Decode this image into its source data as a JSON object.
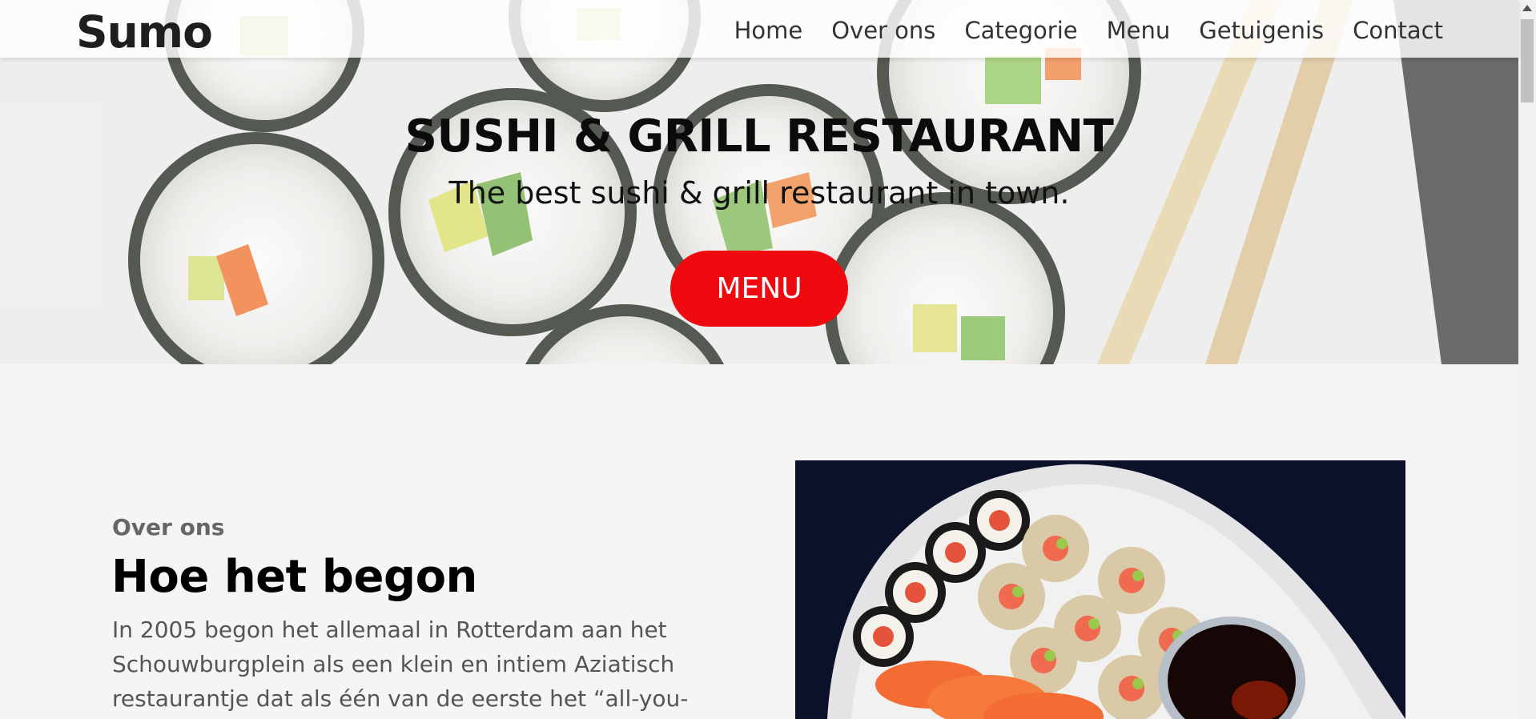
{
  "nav": {
    "logo": "Sumo",
    "links": [
      "Home",
      "Over ons",
      "Categorie",
      "Menu",
      "Getuigenis",
      "Contact"
    ]
  },
  "hero": {
    "title": "SUSHI & GRILL RESTAURANT",
    "subtitle": "The best sushi & grill restaurant in town.",
    "button_label": "MENU"
  },
  "about": {
    "label": "Over ons",
    "title": "Hoe het begon",
    "text": "In 2005 begon het allemaal in Rotterdam aan het Schouwburgplein als een klein en intiem Aziatisch restaurantje dat als één van de eerste het “all-you-"
  },
  "colors": {
    "accent": "#ef0a10",
    "background": "#f5f5f7",
    "text": "#555555"
  },
  "icons": {
    "hero_image": "sushi-rolls-photo",
    "about_image": "sushi-platter-photo"
  }
}
